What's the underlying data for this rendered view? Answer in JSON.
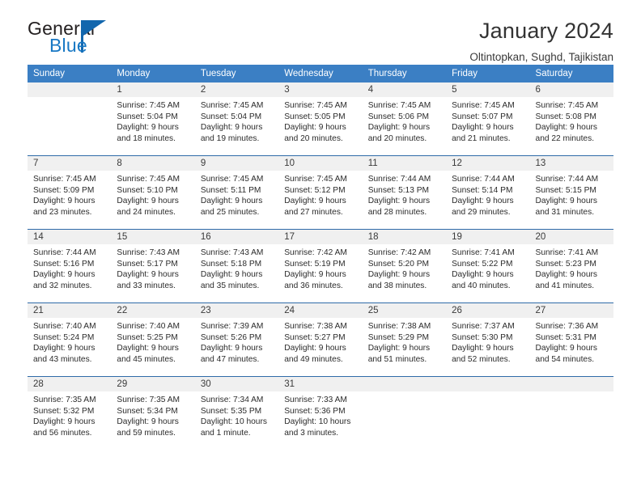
{
  "brand": {
    "name_part1": "General",
    "name_part2": "Blue",
    "logo_icon": "triangle-flag-icon"
  },
  "header": {
    "title": "January 2024",
    "subtitle": "Oltintopkan, Sughd, Tajikistan"
  },
  "colors": {
    "header_blue": "#3b7fc4",
    "row_divider_blue": "#2f6ba8",
    "daynum_band": "#f0f0f0",
    "brand_blue": "#1878c4",
    "text": "#2b2b2b"
  },
  "weekday_headers": [
    "Sunday",
    "Monday",
    "Tuesday",
    "Wednesday",
    "Thursday",
    "Friday",
    "Saturday"
  ],
  "weeks": [
    [
      {
        "day": "",
        "lines": []
      },
      {
        "day": "1",
        "lines": [
          "Sunrise: 7:45 AM",
          "Sunset: 5:04 PM",
          "Daylight: 9 hours",
          "and 18 minutes."
        ]
      },
      {
        "day": "2",
        "lines": [
          "Sunrise: 7:45 AM",
          "Sunset: 5:04 PM",
          "Daylight: 9 hours",
          "and 19 minutes."
        ]
      },
      {
        "day": "3",
        "lines": [
          "Sunrise: 7:45 AM",
          "Sunset: 5:05 PM",
          "Daylight: 9 hours",
          "and 20 minutes."
        ]
      },
      {
        "day": "4",
        "lines": [
          "Sunrise: 7:45 AM",
          "Sunset: 5:06 PM",
          "Daylight: 9 hours",
          "and 20 minutes."
        ]
      },
      {
        "day": "5",
        "lines": [
          "Sunrise: 7:45 AM",
          "Sunset: 5:07 PM",
          "Daylight: 9 hours",
          "and 21 minutes."
        ]
      },
      {
        "day": "6",
        "lines": [
          "Sunrise: 7:45 AM",
          "Sunset: 5:08 PM",
          "Daylight: 9 hours",
          "and 22 minutes."
        ]
      }
    ],
    [
      {
        "day": "7",
        "lines": [
          "Sunrise: 7:45 AM",
          "Sunset: 5:09 PM",
          "Daylight: 9 hours",
          "and 23 minutes."
        ]
      },
      {
        "day": "8",
        "lines": [
          "Sunrise: 7:45 AM",
          "Sunset: 5:10 PM",
          "Daylight: 9 hours",
          "and 24 minutes."
        ]
      },
      {
        "day": "9",
        "lines": [
          "Sunrise: 7:45 AM",
          "Sunset: 5:11 PM",
          "Daylight: 9 hours",
          "and 25 minutes."
        ]
      },
      {
        "day": "10",
        "lines": [
          "Sunrise: 7:45 AM",
          "Sunset: 5:12 PM",
          "Daylight: 9 hours",
          "and 27 minutes."
        ]
      },
      {
        "day": "11",
        "lines": [
          "Sunrise: 7:44 AM",
          "Sunset: 5:13 PM",
          "Daylight: 9 hours",
          "and 28 minutes."
        ]
      },
      {
        "day": "12",
        "lines": [
          "Sunrise: 7:44 AM",
          "Sunset: 5:14 PM",
          "Daylight: 9 hours",
          "and 29 minutes."
        ]
      },
      {
        "day": "13",
        "lines": [
          "Sunrise: 7:44 AM",
          "Sunset: 5:15 PM",
          "Daylight: 9 hours",
          "and 31 minutes."
        ]
      }
    ],
    [
      {
        "day": "14",
        "lines": [
          "Sunrise: 7:44 AM",
          "Sunset: 5:16 PM",
          "Daylight: 9 hours",
          "and 32 minutes."
        ]
      },
      {
        "day": "15",
        "lines": [
          "Sunrise: 7:43 AM",
          "Sunset: 5:17 PM",
          "Daylight: 9 hours",
          "and 33 minutes."
        ]
      },
      {
        "day": "16",
        "lines": [
          "Sunrise: 7:43 AM",
          "Sunset: 5:18 PM",
          "Daylight: 9 hours",
          "and 35 minutes."
        ]
      },
      {
        "day": "17",
        "lines": [
          "Sunrise: 7:42 AM",
          "Sunset: 5:19 PM",
          "Daylight: 9 hours",
          "and 36 minutes."
        ]
      },
      {
        "day": "18",
        "lines": [
          "Sunrise: 7:42 AM",
          "Sunset: 5:20 PM",
          "Daylight: 9 hours",
          "and 38 minutes."
        ]
      },
      {
        "day": "19",
        "lines": [
          "Sunrise: 7:41 AM",
          "Sunset: 5:22 PM",
          "Daylight: 9 hours",
          "and 40 minutes."
        ]
      },
      {
        "day": "20",
        "lines": [
          "Sunrise: 7:41 AM",
          "Sunset: 5:23 PM",
          "Daylight: 9 hours",
          "and 41 minutes."
        ]
      }
    ],
    [
      {
        "day": "21",
        "lines": [
          "Sunrise: 7:40 AM",
          "Sunset: 5:24 PM",
          "Daylight: 9 hours",
          "and 43 minutes."
        ]
      },
      {
        "day": "22",
        "lines": [
          "Sunrise: 7:40 AM",
          "Sunset: 5:25 PM",
          "Daylight: 9 hours",
          "and 45 minutes."
        ]
      },
      {
        "day": "23",
        "lines": [
          "Sunrise: 7:39 AM",
          "Sunset: 5:26 PM",
          "Daylight: 9 hours",
          "and 47 minutes."
        ]
      },
      {
        "day": "24",
        "lines": [
          "Sunrise: 7:38 AM",
          "Sunset: 5:27 PM",
          "Daylight: 9 hours",
          "and 49 minutes."
        ]
      },
      {
        "day": "25",
        "lines": [
          "Sunrise: 7:38 AM",
          "Sunset: 5:29 PM",
          "Daylight: 9 hours",
          "and 51 minutes."
        ]
      },
      {
        "day": "26",
        "lines": [
          "Sunrise: 7:37 AM",
          "Sunset: 5:30 PM",
          "Daylight: 9 hours",
          "and 52 minutes."
        ]
      },
      {
        "day": "27",
        "lines": [
          "Sunrise: 7:36 AM",
          "Sunset: 5:31 PM",
          "Daylight: 9 hours",
          "and 54 minutes."
        ]
      }
    ],
    [
      {
        "day": "28",
        "lines": [
          "Sunrise: 7:35 AM",
          "Sunset: 5:32 PM",
          "Daylight: 9 hours",
          "and 56 minutes."
        ]
      },
      {
        "day": "29",
        "lines": [
          "Sunrise: 7:35 AM",
          "Sunset: 5:34 PM",
          "Daylight: 9 hours",
          "and 59 minutes."
        ]
      },
      {
        "day": "30",
        "lines": [
          "Sunrise: 7:34 AM",
          "Sunset: 5:35 PM",
          "Daylight: 10 hours",
          "and 1 minute."
        ]
      },
      {
        "day": "31",
        "lines": [
          "Sunrise: 7:33 AM",
          "Sunset: 5:36 PM",
          "Daylight: 10 hours",
          "and 3 minutes."
        ]
      },
      {
        "day": "",
        "lines": []
      },
      {
        "day": "",
        "lines": []
      },
      {
        "day": "",
        "lines": []
      }
    ]
  ]
}
